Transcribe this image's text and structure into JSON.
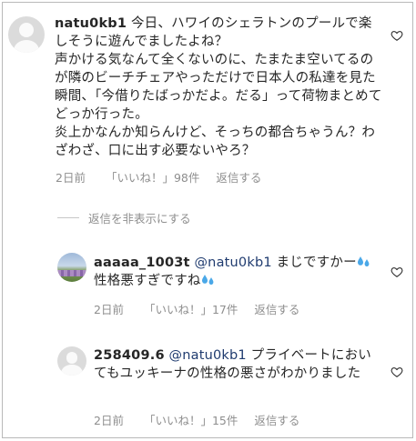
{
  "comments": [
    {
      "username": "natu0kb1",
      "text": "今日、ハワイのシェラトンのプールで楽しそうに遊んでましたよね？\n声かける気なんて全くないのに、たまたま空いてるのが隣のビーチチェアやっただけで日本人の私達を見た瞬間、「今借りたばっかだよ。だる」って荷物まとめてどっか行った。\n炎上かなんか知らんけど、そっちの都合ちゃうん？わざわざ、口に出す必要ないやろ？",
      "time": "2日前",
      "likes": "「いいね！」98件",
      "reply": "返信する"
    }
  ],
  "toggle_replies": "返信を非表示にする",
  "replies": [
    {
      "username": "aaaaa_1003t",
      "mention": "@natu0kb1",
      "text_a": " まじですかー",
      "text_b": "性格悪すぎですね",
      "time": "2日前",
      "likes": "「いいね！」17件",
      "reply": "返信する"
    },
    {
      "username": "258409.6",
      "mention": "@natu0kb1",
      "text": " プライベートにおいてもユッキーナの性格の悪さがわかりました",
      "time": "2日前",
      "likes": "「いいね！」15件",
      "reply": "返信する"
    }
  ],
  "icons": {
    "heart": "heart-outline-icon",
    "sweat": "sweat-droplets-emoji",
    "avatar_default": "default-avatar-icon"
  },
  "colors": {
    "text": "#262626",
    "secondary": "#8e8e8e",
    "mention": "#1f3b6f",
    "emoji": "#4aa8e8"
  }
}
